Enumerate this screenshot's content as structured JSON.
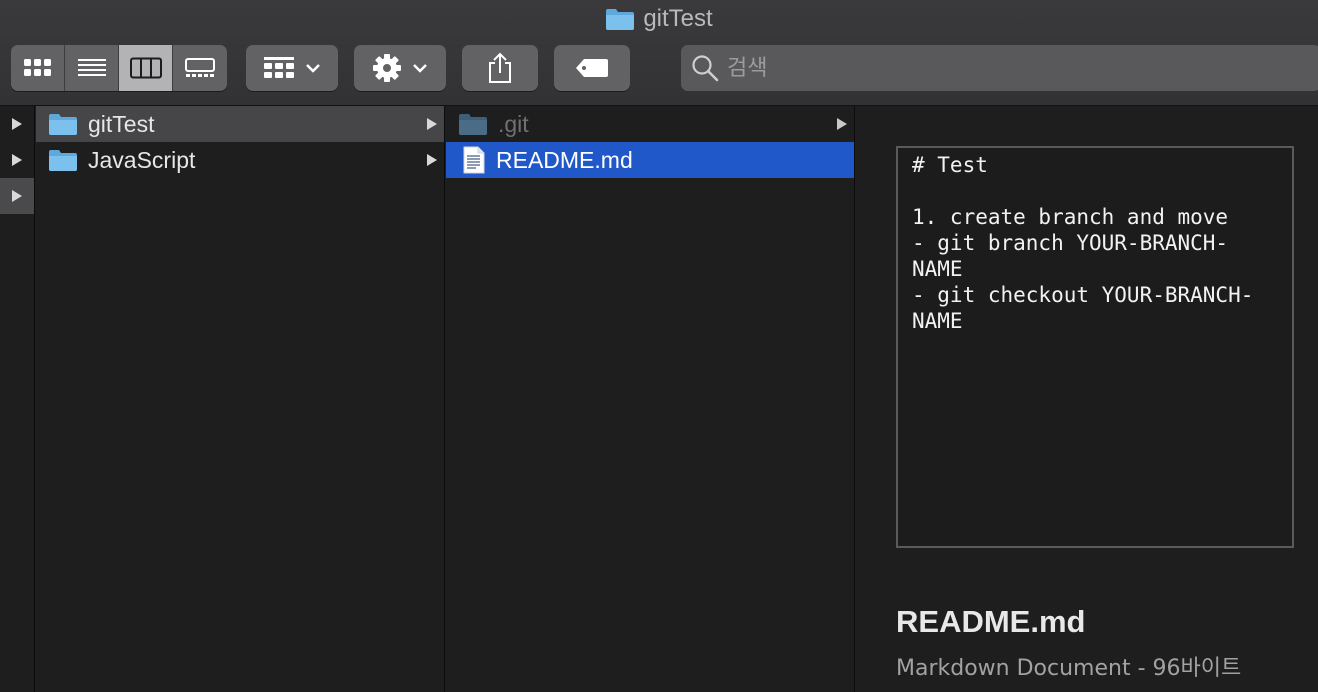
{
  "window": {
    "title": "gitTest"
  },
  "toolbar": {
    "view_modes": [
      "icon-view",
      "list-view",
      "column-view",
      "gallery-view"
    ],
    "active_view": "column-view",
    "group_icon": "group-grid-icon",
    "action_icon": "gear-icon",
    "share_icon": "share-icon",
    "tag_icon": "tag-icon",
    "search_placeholder": "검색"
  },
  "columns": {
    "root_items": [
      {
        "label": "gitTest",
        "icon": "folder-icon",
        "selected": true
      },
      {
        "label": "JavaScript",
        "icon": "folder-icon",
        "selected": false
      }
    ],
    "gittest_items": [
      {
        "label": ".git",
        "icon": "folder-icon",
        "hidden": true
      },
      {
        "label": "README.md",
        "icon": "document-icon",
        "selected": true
      }
    ]
  },
  "preview": {
    "content": "# Test\n\n1. create branch and move\n- git branch YOUR-BRANCH-NAME\n- git checkout YOUR-BRANCH-NAME",
    "filename": "README.md",
    "info": "Markdown Document - 96바이트"
  },
  "colors": {
    "selection": "#2058c9",
    "accent_folder": "#6fb7e8"
  }
}
